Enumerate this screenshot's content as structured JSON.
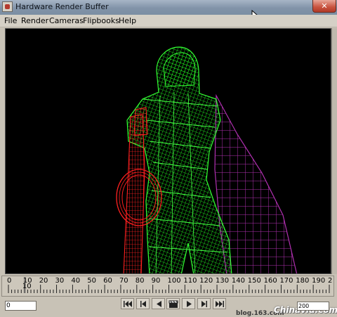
{
  "window": {
    "title": "Hardware Render Buffer",
    "close_glyph": "✕"
  },
  "menubar": {
    "items": [
      "File",
      "Render",
      "Cameras",
      "Flipbooks",
      "Help"
    ]
  },
  "viewport": {
    "background": "#000000",
    "wire_colors": {
      "character": "#20ff20",
      "sword": "#ff1a1a",
      "cloth": "#b030b0"
    }
  },
  "timeline": {
    "ticks": [
      "0",
      "10",
      "20",
      "30",
      "40",
      "50",
      "60",
      "70",
      "80",
      "90",
      "100",
      "110",
      "120",
      "130",
      "140",
      "150",
      "160",
      "170",
      "180",
      "190",
      "2"
    ],
    "current_frame_label": "10",
    "current_frame_under": "10"
  },
  "controls": {
    "start_frame": "0",
    "end_frame": "200",
    "icons": [
      "go-to-start-icon",
      "step-back-key-icon",
      "step-back-icon",
      "play-forward-icon-clapper",
      "play-icon",
      "step-forward-key-icon",
      "go-to-end-icon"
    ]
  },
  "watermark": {
    "url": "blog.163.com",
    "logo": "Chinavid.com"
  }
}
